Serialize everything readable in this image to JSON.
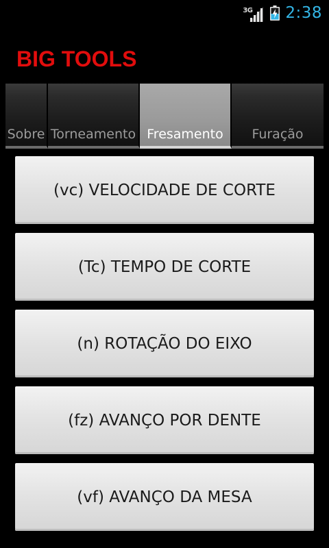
{
  "status_bar": {
    "network_type": "3G",
    "signal_icon": "signal-icon",
    "battery_icon": "battery-charging-icon",
    "time": "2:38",
    "clock_color": "#33b5e5"
  },
  "app": {
    "title": "BIG TOOLS",
    "title_color": "#e10d0d"
  },
  "tabs": [
    {
      "label": "Sobre",
      "selected": false
    },
    {
      "label": "Torneamento",
      "selected": false
    },
    {
      "label": "Fresamento",
      "selected": true
    },
    {
      "label": "Furação",
      "selected": false
    }
  ],
  "menu": {
    "items": [
      {
        "label": "(vc) VELOCIDADE DE CORTE"
      },
      {
        "label": "(Tc) TEMPO DE CORTE"
      },
      {
        "label": "(n) ROTAÇÃO DO EIXO"
      },
      {
        "label": "(fz) AVANÇO POR DENTE"
      },
      {
        "label": "(vf) AVANÇO DA MESA"
      }
    ]
  }
}
